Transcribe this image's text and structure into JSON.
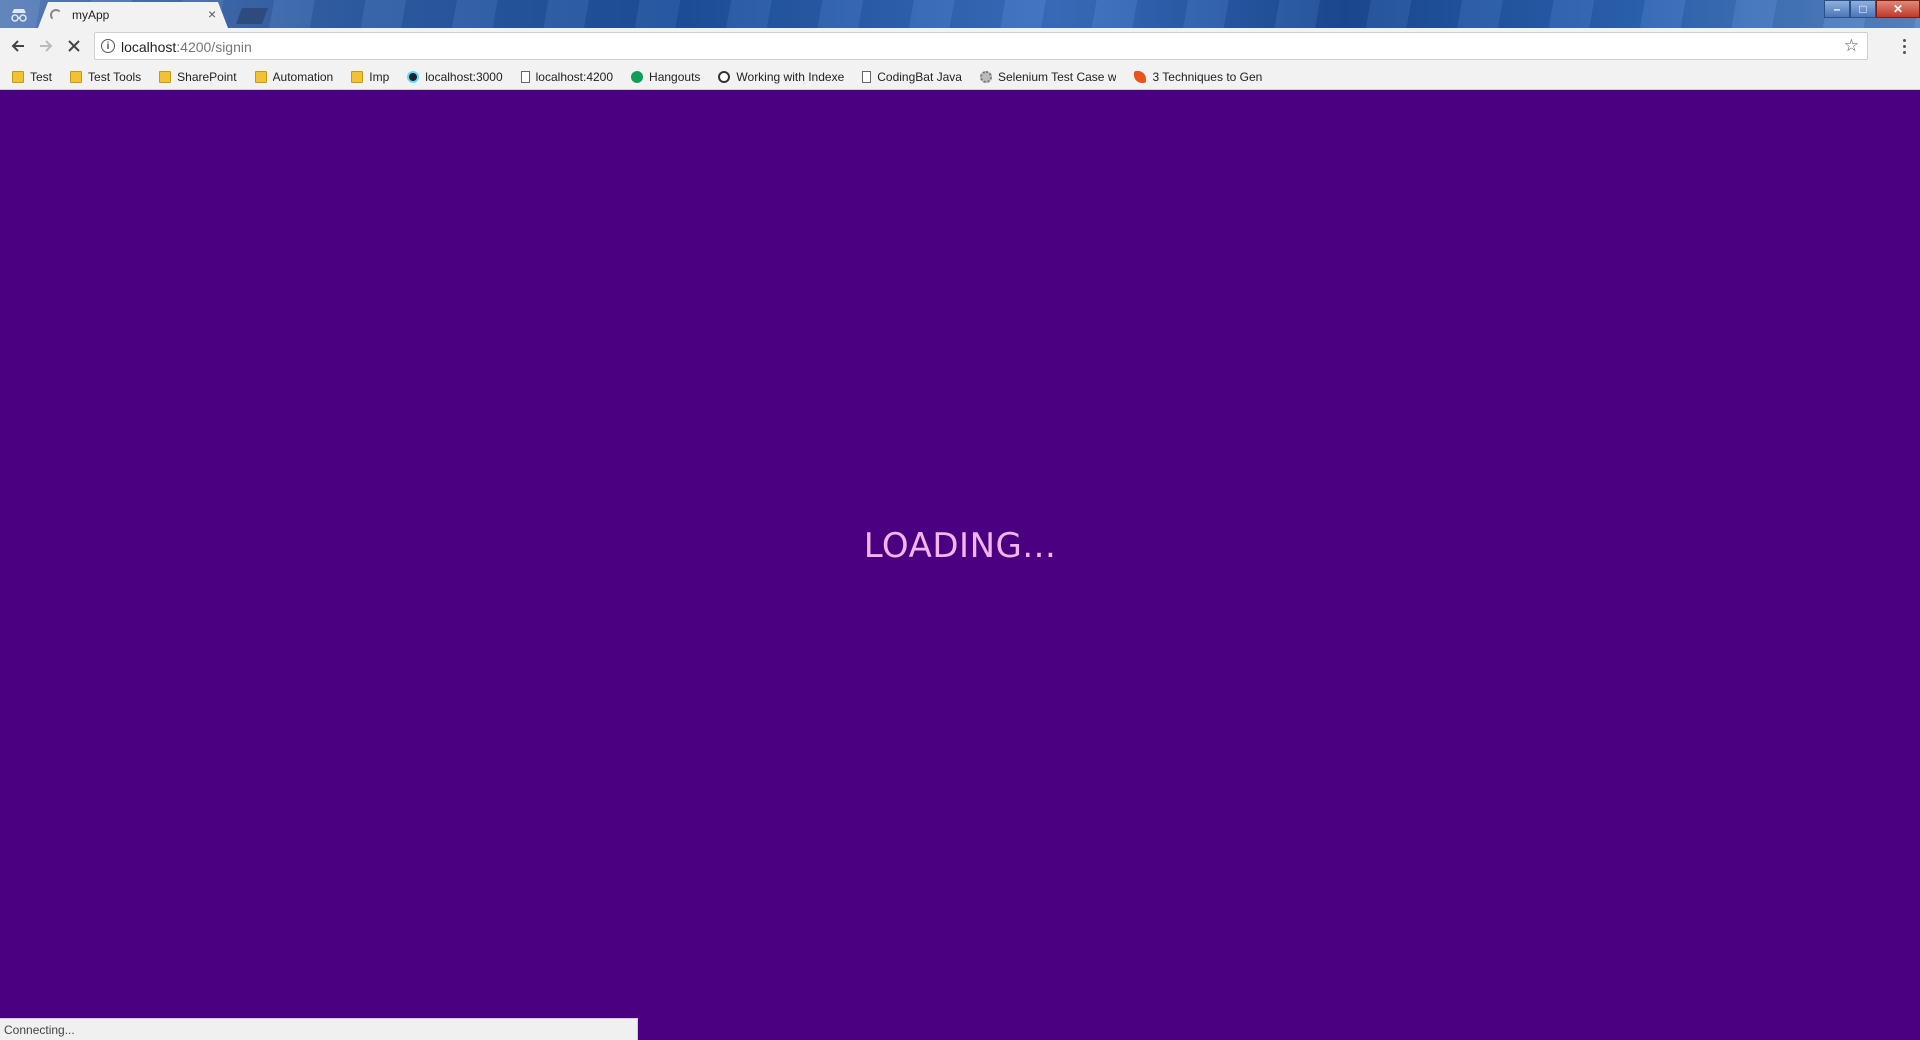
{
  "browser": {
    "tab": {
      "title": "myApp",
      "close_glyph": "×"
    },
    "window_controls": {
      "minimize": "–",
      "maximize": "□",
      "close": "✕"
    },
    "toolbar": {
      "url_host": "localhost",
      "url_path": ":4200/signin",
      "icons": [
        "back-arrow-icon",
        "forward-arrow-icon",
        "stop-loading-icon",
        "info-icon",
        "star-icon",
        "menu-icon"
      ]
    },
    "bookmarks": [
      {
        "label": "Test",
        "icon": "folder-icon"
      },
      {
        "label": "Test Tools",
        "icon": "folder-icon"
      },
      {
        "label": "SharePoint",
        "icon": "folder-icon"
      },
      {
        "label": "Automation",
        "icon": "folder-icon"
      },
      {
        "label": "Imp",
        "icon": "folder-icon"
      },
      {
        "label": "localhost:3000",
        "icon": "react-icon"
      },
      {
        "label": "localhost:4200",
        "icon": "page-icon"
      },
      {
        "label": "Hangouts",
        "icon": "hangouts-icon"
      },
      {
        "label": "Working with Indexe",
        "icon": "site-icon"
      },
      {
        "label": "CodingBat Java",
        "icon": "page-icon"
      },
      {
        "label": "Selenium Test Case w",
        "icon": "gear-icon"
      },
      {
        "label": "3 Techniques to Gen",
        "icon": "flame-icon"
      }
    ]
  },
  "page": {
    "loading_text": "LOADING...",
    "background_color": "#4b0082",
    "text_color": "#f2b7e8"
  },
  "status": {
    "text": "Connecting..."
  }
}
